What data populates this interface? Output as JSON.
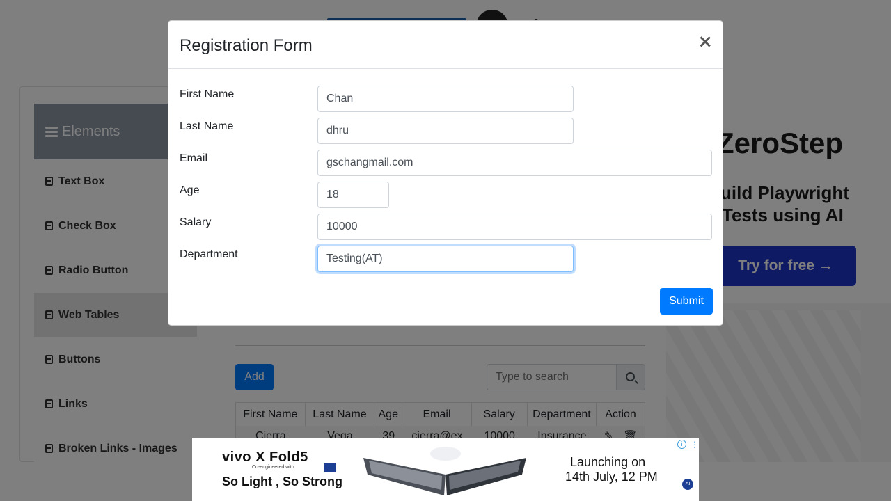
{
  "sidebar": {
    "header": "Elements",
    "items": [
      {
        "label": "Text Box"
      },
      {
        "label": "Check Box"
      },
      {
        "label": "Radio Button"
      },
      {
        "label": "Web Tables"
      },
      {
        "label": "Buttons"
      },
      {
        "label": "Links"
      },
      {
        "label": "Broken Links - Images"
      }
    ]
  },
  "table": {
    "add_label": "Add",
    "search_placeholder": "Type to search",
    "columns": [
      "First Name",
      "Last Name",
      "Age",
      "Email",
      "Salary",
      "Department",
      "Action"
    ],
    "rows": [
      {
        "first": "Cierra",
        "last": "Vega",
        "age": "39",
        "email": "cierra@ex",
        "salary": "10000",
        "department": "Insurance"
      }
    ]
  },
  "ad_right": {
    "brand": "ZeroStep",
    "line1": "uild Playwright",
    "line2": "Tests using AI",
    "cta": "Try for free →"
  },
  "modal": {
    "title": "Registration Form",
    "close": "×",
    "fields": [
      {
        "label": "First Name",
        "value": "Chan"
      },
      {
        "label": "Last Name",
        "value": "dhru"
      },
      {
        "label": "Email",
        "value": "gschangmail.com"
      },
      {
        "label": "Age",
        "value": "18"
      },
      {
        "label": "Salary",
        "value": "10000"
      },
      {
        "label": "Department",
        "value": "Testing(AT)"
      }
    ],
    "submit": "Submit"
  },
  "ad_bottom": {
    "brand": "vivo X Fold5",
    "sub": "Co-engineered with",
    "tagline": "So Light , So Strong",
    "launch1": "Launching on",
    "launch2": "14th July, 12 PM",
    "info": "i",
    "ai": "AI"
  },
  "colors": {
    "primary": "#007bff",
    "overlay": "rgba(0,0,0,0.5)",
    "ad_cta": "#1d34c8"
  }
}
